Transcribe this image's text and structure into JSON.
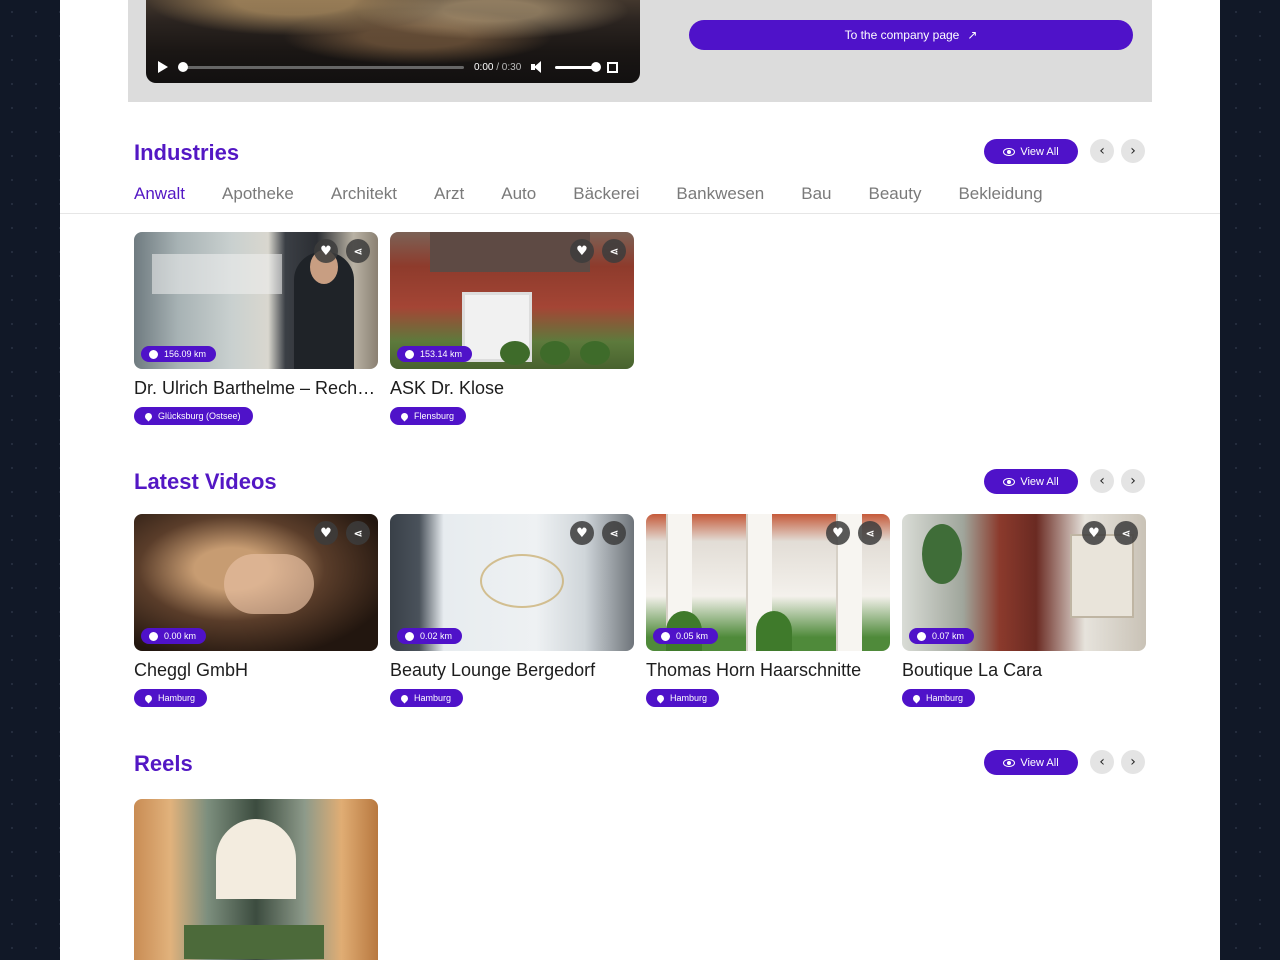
{
  "video": {
    "current_time": "0:00",
    "duration": "/ 0:30",
    "progress": 0,
    "volume": 1
  },
  "company_button": {
    "label": "To the company page",
    "icon": "arrow-up-right-icon"
  },
  "industries": {
    "title": "Industries",
    "view_all": "View All",
    "tabs": [
      {
        "label": "Anwalt",
        "active": true
      },
      {
        "label": "Apotheke"
      },
      {
        "label": "Architekt"
      },
      {
        "label": "Arzt"
      },
      {
        "label": "Auto"
      },
      {
        "label": "Bäckerei"
      },
      {
        "label": "Bankwesen"
      },
      {
        "label": "Bau"
      },
      {
        "label": "Beauty"
      },
      {
        "label": "Bekleidung"
      }
    ],
    "cards": [
      {
        "title": "Dr. Ulrich Barthelme – Rechtsanwalt & Notar",
        "distance": "156.09 km",
        "location": "Glücksburg (Ostsee)"
      },
      {
        "title": "ASK Dr. Klose",
        "distance": "153.14 km",
        "location": "Flensburg"
      }
    ]
  },
  "latest_videos": {
    "title": "Latest Videos",
    "view_all": "View All",
    "cards": [
      {
        "title": "Cheggl GmbH",
        "distance": "0.00 km",
        "location": "Hamburg"
      },
      {
        "title": "Beauty Lounge Bergedorf",
        "distance": "0.02 km",
        "location": "Hamburg"
      },
      {
        "title": "Thomas Horn Haarschnitte",
        "distance": "0.05 km",
        "location": "Hamburg"
      },
      {
        "title": "Boutique La Cara",
        "distance": "0.07 km",
        "location": "Hamburg"
      }
    ]
  },
  "reels": {
    "title": "Reels",
    "view_all": "View All"
  },
  "colors": {
    "accent": "#4f12c9",
    "heading": "#5317c4"
  }
}
